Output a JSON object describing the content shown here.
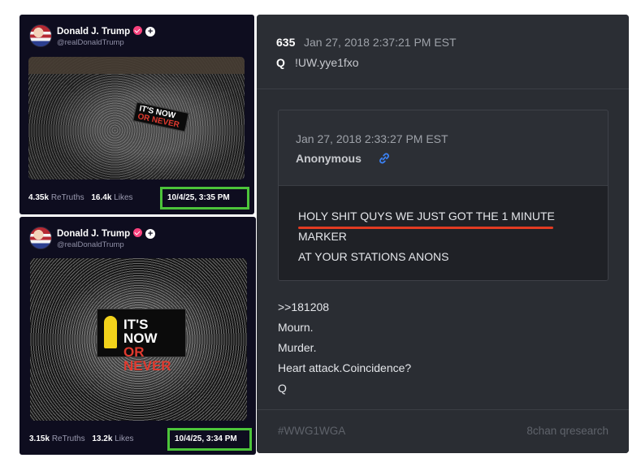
{
  "posts": [
    {
      "author": "Donald J. Trump",
      "handle": "@realDonaldTrump",
      "banner_line1": "IT'S NOW",
      "banner_line2": "OR NEVER",
      "retruths_count": "4.35k",
      "retruths_label": "ReTruths",
      "likes_count": "16.4k",
      "likes_label": "Likes",
      "timestamp": "10/4/25, 3:35 PM"
    },
    {
      "author": "Donald J. Trump",
      "handle": "@realDonaldTrump",
      "banner_line1": "IT'S NOW",
      "banner_line2": "OR NEVER",
      "retruths_count": "3.15k",
      "retruths_label": "ReTruths",
      "likes_count": "13.2k",
      "likes_label": "Likes",
      "timestamp": "10/4/25, 3:34 PM"
    }
  ],
  "highlight_color": "#4cc43a",
  "verified_color": "#f8417d",
  "q_post": {
    "number": "635",
    "date": "Jan 27, 2018 2:37:21 PM EST",
    "name": "Q",
    "tripcode": "!UW.yye1fxo",
    "quoted": {
      "date": "Jan 27, 2018 2:33:27 PM EST",
      "author": "Anonymous",
      "lines": [
        "HOLY SHIT QUYS WE JUST GOT THE 1 MINUTE",
        "MARKER",
        "AT YOUR STATIONS ANONS"
      ],
      "underline_color": "#e23b22"
    },
    "body": [
      ">>181208",
      "Mourn.",
      "Murder.",
      "Heart attack.Coincidence?",
      "Q"
    ],
    "hashtag": "#WWG1WGA",
    "source": "8chan qresearch"
  }
}
